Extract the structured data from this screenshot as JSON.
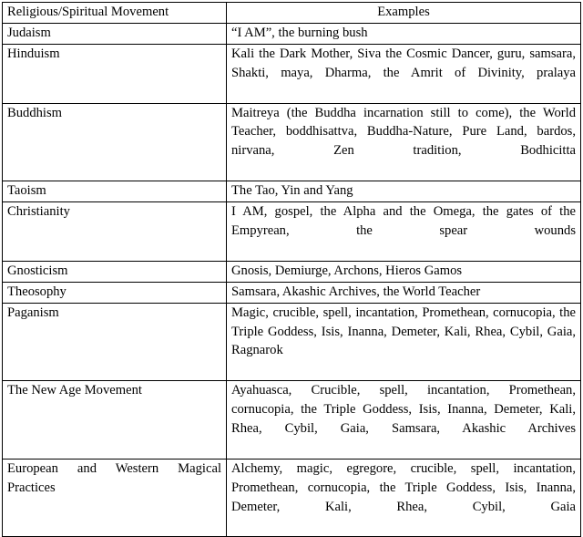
{
  "table": {
    "columns": [
      {
        "key": "movement",
        "label": "Religious/Spiritual Movement",
        "align": "left"
      },
      {
        "key": "examples",
        "label": "Examples",
        "align": "center"
      }
    ],
    "rows": [
      {
        "movement": "Judaism",
        "examples": "“I AM”, the burning bush",
        "movement_lines": 1,
        "examples_lines": 1
      },
      {
        "movement": "Hinduism",
        "examples": "Kali the Dark Mother, Siva the Cosmic Dancer, guru, samsara, Shakti, maya, Dharma, the Am­rit of Divinity, pralaya",
        "movement_lines": 1,
        "examples_lines": 3
      },
      {
        "movement": "Buddhism",
        "examples": "Maitreya (the Buddha incarnation still to come), the World Teacher, boddhisattva, Buddha-Nature, Pure Land, bardos, nirvana, Zen tradition, Bodhicitta",
        "movement_lines": 1,
        "examples_lines": 4
      },
      {
        "movement": "Taoism",
        "examples": "The Tao, Yin and Yang",
        "movement_lines": 1,
        "examples_lines": 1
      },
      {
        "movement": "Christianity",
        "examples": "I AM, gospel, the Alpha and the Omega, the gates of the Empyrean, the spear wounds",
        "movement_lines": 1,
        "examples_lines": 2
      },
      {
        "movement": "Gnosticism",
        "examples": "Gnosis, Demiurge, Archons, Hieros Gamos",
        "movement_lines": 1,
        "examples_lines": 1
      },
      {
        "movement": "Theosophy",
        "examples": "Samsara, Akashic Archives, the World Teacher",
        "movement_lines": 1,
        "examples_lines": 1
      },
      {
        "movement": "Paganism",
        "examples": "Magic, crucible, spell, incantation, Promethean, cornucopia, the Triple Goddess, Isis, Inanna, Demeter, Kali, Rhea, Cybil, Gaia, Ragnarok",
        "movement_lines": 1,
        "examples_lines": 3
      },
      {
        "movement": "The New Age Movement",
        "examples": "Ayahuasca, Crucible, spell, incantation, Promethean, cornucopia, the Triple Goddess, Isis, Inanna, Demeter, Kali, Rhea, Cybil, Gaia, Samsara, Akashic Archives",
        "movement_lines": 1,
        "examples_lines": 4
      },
      {
        "movement": "European and Western Magi­cal Practices",
        "examples": "Alchemy, magic, egregore, crucible, spell, in­cantation, Promethean, cornucopia, the Triple Goddess, Isis, Inanna, Demeter, Kali, Rhea, Cy­bil, Gaia",
        "movement_lines": 2,
        "examples_lines": 4
      }
    ]
  },
  "style": {
    "border_color": "#000000",
    "text_color": "#000000",
    "background": "#ffffff"
  }
}
